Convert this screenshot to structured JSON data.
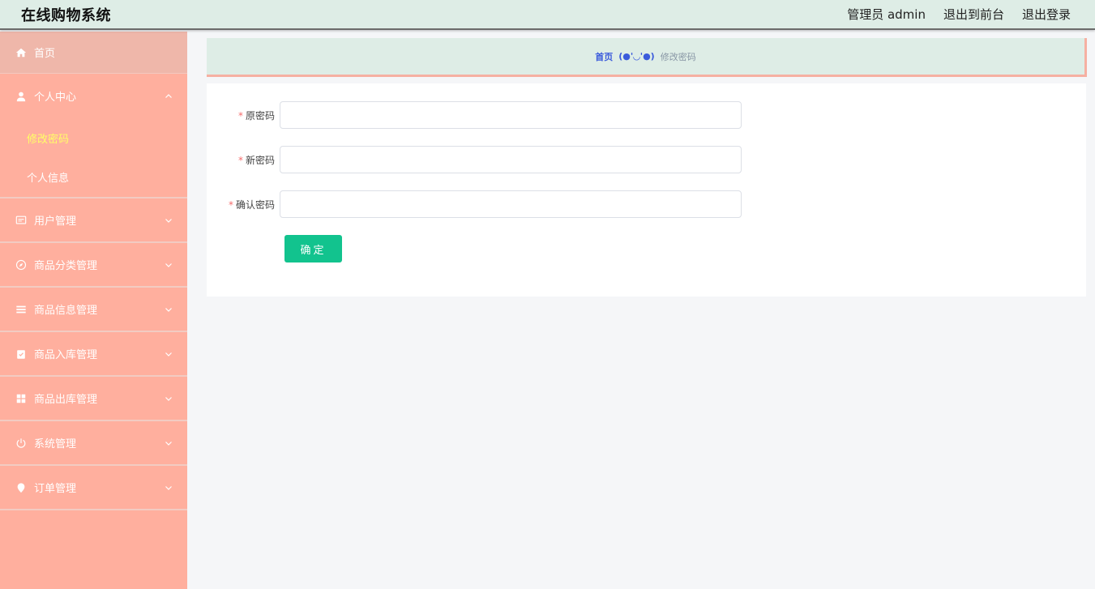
{
  "header": {
    "title": "在线购物系统",
    "user": "管理员 admin",
    "front_link": "退出到前台",
    "logout": "退出登录"
  },
  "sidebar": {
    "home": "首页",
    "personal": "个人中心",
    "change_password": "修改密码",
    "profile": "个人信息",
    "user_mgmt": "用户管理",
    "category_mgmt": "商品分类管理",
    "product_mgmt": "商品信息管理",
    "stock_in_mgmt": "商品入库管理",
    "stock_out_mgmt": "商品出库管理",
    "system_mgmt": "系统管理",
    "order_mgmt": "订单管理"
  },
  "breadcrumb": {
    "home": "首页",
    "separator": "(●'◡'●)",
    "current": "修改密码"
  },
  "form": {
    "old_password_label": "原密码",
    "new_password_label": "新密码",
    "confirm_password_label": "确认密码",
    "required_mark": "*",
    "old_password_value": "",
    "new_password_value": "",
    "confirm_password_value": "",
    "submit_label": "确定"
  },
  "colors": {
    "header_bg": "#deede6",
    "sidebar_bg": "#ffaf9e",
    "active_submenu": "#ffff66",
    "submit_button": "#12c38e",
    "breadcrumb_link": "#3b5bdb"
  }
}
